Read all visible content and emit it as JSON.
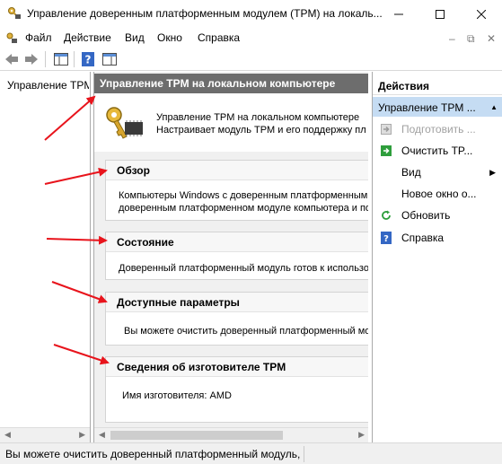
{
  "window": {
    "title": "Управление доверенным платформенным модулем (TPM) на локаль...",
    "icons": {
      "app": "tpm-key-icon",
      "minimize": "minimize-icon",
      "maximize": "maximize-icon",
      "close": "close-icon"
    }
  },
  "menu": {
    "items": [
      "Файл",
      "Действие",
      "Вид",
      "Окно",
      "Справка"
    ],
    "mdi": [
      "–",
      "⧉",
      "✕"
    ]
  },
  "toolbar": {
    "buttons": [
      "back-arrow-icon",
      "forward-arrow-icon",
      "console-tree-icon",
      "help-icon",
      "action-pane-icon"
    ]
  },
  "tree": {
    "root_label": "Управление TPM на локальном компьютере"
  },
  "center": {
    "header": "Управление TPM на локальном компьютере",
    "intro_line1": "Управление TPM на локальном компьютере",
    "intro_line2": "Настраивает модуль TPM и его поддержку пл",
    "sections": [
      {
        "title": "Обзор",
        "line1": "Компьютеры Windows с доверенным платформенным",
        "line2": "доверенным платформенном модуле компьютера и по"
      },
      {
        "title": "Состояние",
        "line1": "Доверенный платформенный модуль готов к использо"
      },
      {
        "title": "Доступные параметры",
        "line1": "Вы можете очистить доверенный платформенный мо"
      },
      {
        "title": "Сведения об изготовителе TPM",
        "line1": "Имя изготовителя:  AMD"
      }
    ]
  },
  "actions": {
    "title": "Действия",
    "group": "Управление TPM ...",
    "items": [
      {
        "label": "Подготовить ...",
        "icon": "prepare-icon",
        "enabled": false
      },
      {
        "label": "Очистить TP...",
        "icon": "clear-icon",
        "enabled": true
      },
      {
        "label": "Вид",
        "icon": "",
        "enabled": true,
        "submenu": true
      },
      {
        "label": "Новое окно о...",
        "icon": "",
        "enabled": true
      },
      {
        "label": "Обновить",
        "icon": "refresh-icon",
        "enabled": true
      },
      {
        "label": "Справка",
        "icon": "help-icon",
        "enabled": true
      }
    ]
  },
  "status": {
    "text": "Вы можете очистить доверенный платформенный модуль, ч"
  },
  "colors": {
    "header_bg": "#6d6d6d",
    "selected_group_bg": "#c5dcf3",
    "arrow_red": "#e8141c",
    "disabled_text": "#a0a0a0",
    "green_action": "#2e9e3c",
    "help_blue": "#3467c4"
  }
}
